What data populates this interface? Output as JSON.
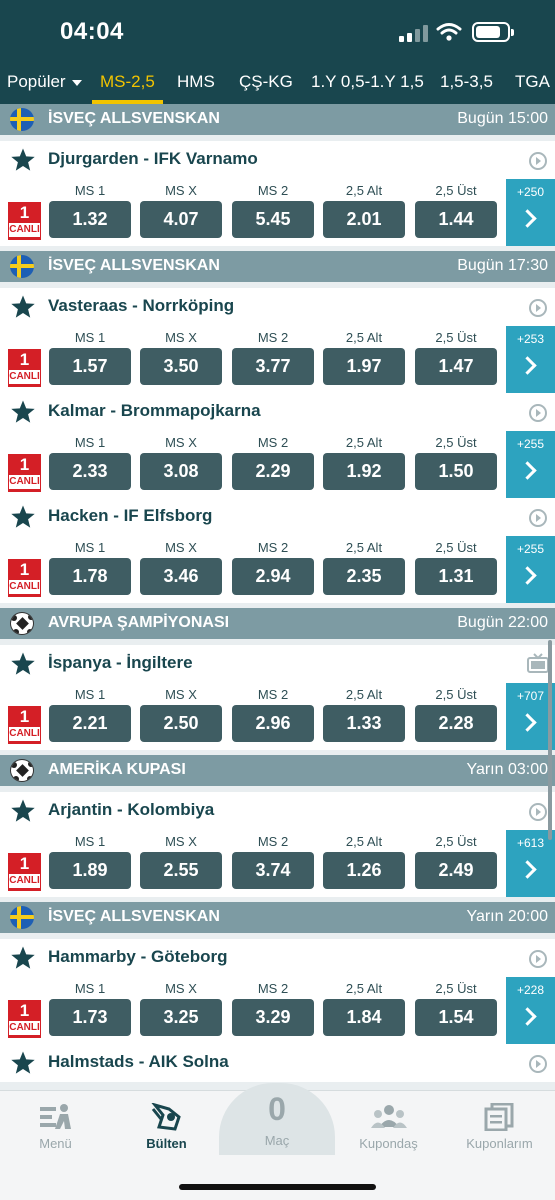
{
  "status_bar": {
    "time": "04:04"
  },
  "tabs": [
    "Popüler",
    "MS-2,5",
    "HMS",
    "ÇŞ-KG",
    "1.Y 0,5-1.Y 1,5",
    "1,5-3,5",
    "TGA"
  ],
  "active_tab": "MS-2,5",
  "odds_labels": [
    "MS 1",
    "MS X",
    "MS 2",
    "2,5 Alt",
    "2,5 Üst"
  ],
  "live_badge": {
    "number": "1",
    "label": "CANLI"
  },
  "leagues": [
    {
      "name": "İSVEÇ ALLSVENSKAN",
      "datetime": "Bugün 15:00",
      "icon": "sweden-flag-icon",
      "matches": [
        {
          "title": "Djurgarden - IFK Varnamo",
          "odds": [
            "1.32",
            "4.07",
            "5.45",
            "2.01",
            "1.44"
          ],
          "more": "+250",
          "side_icon": "info-icon"
        }
      ]
    },
    {
      "name": "İSVEÇ ALLSVENSKAN",
      "datetime": "Bugün 17:30",
      "icon": "sweden-flag-icon",
      "matches": [
        {
          "title": "Vasteraas - Norrköping",
          "odds": [
            "1.57",
            "3.50",
            "3.77",
            "1.97",
            "1.47"
          ],
          "more": "+253",
          "side_icon": "info-icon"
        },
        {
          "title": "Kalmar - Brommapojkarna",
          "odds": [
            "2.33",
            "3.08",
            "2.29",
            "1.92",
            "1.50"
          ],
          "more": "+255",
          "side_icon": "info-icon"
        },
        {
          "title": "Hacken - IF Elfsborg",
          "odds": [
            "1.78",
            "3.46",
            "2.94",
            "2.35",
            "1.31"
          ],
          "more": "+255",
          "side_icon": "info-icon"
        }
      ]
    },
    {
      "name": "AVRUPA ŞAMPİYONASI",
      "datetime": "Bugün 22:00",
      "icon": "soccer-ball-icon",
      "matches": [
        {
          "title": "İspanya - İngiltere",
          "odds": [
            "2.21",
            "2.50",
            "2.96",
            "1.33",
            "2.28"
          ],
          "more": "+707",
          "side_icon": "tv-icon"
        }
      ]
    },
    {
      "name": "AMERİKA KUPASI",
      "datetime": "Yarın 03:00",
      "icon": "soccer-ball-icon",
      "matches": [
        {
          "title": "Arjantin - Kolombiya",
          "odds": [
            "1.89",
            "2.55",
            "3.74",
            "1.26",
            "2.49"
          ],
          "more": "+613",
          "side_icon": "info-icon"
        }
      ]
    },
    {
      "name": "İSVEÇ ALLSVENSKAN",
      "datetime": "Yarın 20:00",
      "icon": "sweden-flag-icon",
      "matches": [
        {
          "title": "Hammarby - Göteborg",
          "odds": [
            "1.73",
            "3.25",
            "3.29",
            "1.84",
            "1.54"
          ],
          "more": "+228",
          "side_icon": "info-icon"
        },
        {
          "title": "Halmstads - AIK Solna",
          "odds": [],
          "more": "",
          "side_icon": "info-icon"
        }
      ]
    }
  ],
  "bottom_nav": [
    {
      "label": "Menü",
      "icon": "menu-icon"
    },
    {
      "label": "Bülten",
      "icon": "bulletin-icon",
      "active": true
    },
    {
      "label": "Maç",
      "count": "0",
      "icon": "match-count"
    },
    {
      "label": "Kupondaş",
      "icon": "community-icon"
    },
    {
      "label": "Kuponlarım",
      "icon": "coupons-icon"
    }
  ],
  "colors": {
    "header": "#19464e",
    "accent": "#f2c400",
    "league_bar": "#7d9ba3",
    "odds_button": "#3f5d63",
    "more_button": "#2da3bf",
    "live": "#d41f26"
  }
}
